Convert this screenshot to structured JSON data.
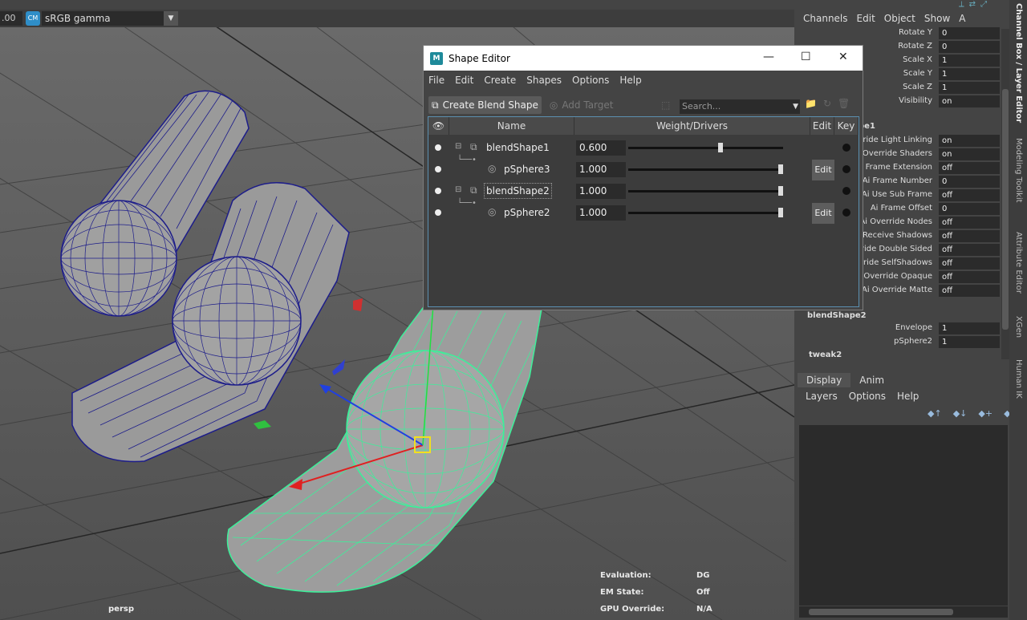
{
  "viewport": {
    "frame_value": ".00",
    "colorspace_icon": "colormanagement-icon",
    "colorspace": "sRGB gamma",
    "camera": "persp",
    "hud": [
      {
        "label": "Evaluation:",
        "value": "DG"
      },
      {
        "label": "EM State:",
        "value": "Off"
      },
      {
        "label": "GPU Override:",
        "value": "N/A"
      }
    ]
  },
  "channel_box": {
    "menu": [
      "Channels",
      "Edit",
      "Object",
      "Show",
      "A"
    ],
    "transform_rows": [
      {
        "label": "Rotate Y",
        "value": "0"
      },
      {
        "label": "Rotate Z",
        "value": "0"
      },
      {
        "label": "Scale X",
        "value": "1"
      },
      {
        "label": "Scale Y",
        "value": "1"
      },
      {
        "label": "Scale Z",
        "value": "1"
      },
      {
        "label": "Visibility",
        "value": "on"
      }
    ],
    "shape_header": "pe1",
    "shape_rows": [
      {
        "label": "rride Light Linking",
        "value": "on"
      },
      {
        "label": "Override Shaders",
        "value": "on"
      },
      {
        "label": "Frame Extension",
        "value": "off"
      },
      {
        "label": "Ai Frame Number",
        "value": "0"
      },
      {
        "label": "Ai Use Sub Frame",
        "value": "off"
      },
      {
        "label": "Ai Frame Offset",
        "value": "0"
      },
      {
        "label": "Ai Override Nodes",
        "value": "off"
      },
      {
        "label": "Receive Shadows",
        "value": "off"
      },
      {
        "label": "rride Double Sided",
        "value": "off"
      },
      {
        "label": "rride SelfShadows",
        "value": "off"
      },
      {
        "label": "Override Opaque",
        "value": "off"
      },
      {
        "label": "Ai Override Matte",
        "value": "off"
      }
    ],
    "blend_header": "blendShape2",
    "blend_rows": [
      {
        "label": "Envelope",
        "value": "1"
      },
      {
        "label": "pSphere2",
        "value": "1"
      }
    ],
    "tweak_header": "tweak2"
  },
  "side_tabs": [
    "Channel Box / Layer Editor",
    "Modeling Toolkit",
    "Attribute Editor",
    "XGen",
    "Human IK"
  ],
  "layer_editor": {
    "tabs": [
      "Display",
      "Anim"
    ],
    "menu": [
      "Layers",
      "Options",
      "Help"
    ]
  },
  "shape_editor": {
    "title": "Shape Editor",
    "window_buttons": [
      "—",
      "☐",
      "✕"
    ],
    "menu": [
      "File",
      "Edit",
      "Create",
      "Shapes",
      "Options",
      "Help"
    ],
    "create_blend_label": "Create Blend Shape",
    "add_target_label": "Add Target",
    "search_placeholder": "Search...",
    "columns": [
      "Name",
      "Weight/Drivers",
      "Edit",
      "Key"
    ],
    "rows": [
      {
        "name": "blendShape1",
        "weight": "0.600",
        "level": 0.6,
        "edit": false
      },
      {
        "name": "pSphere3",
        "weight": "1.000",
        "level": 1.0,
        "edit": true,
        "edit_label": "Edit"
      },
      {
        "name": "blendShape2",
        "weight": "1.000",
        "level": 1.0,
        "edit": false
      },
      {
        "name": "pSphere2",
        "weight": "1.000",
        "level": 1.0,
        "edit": true,
        "edit_label": "Edit"
      }
    ]
  }
}
